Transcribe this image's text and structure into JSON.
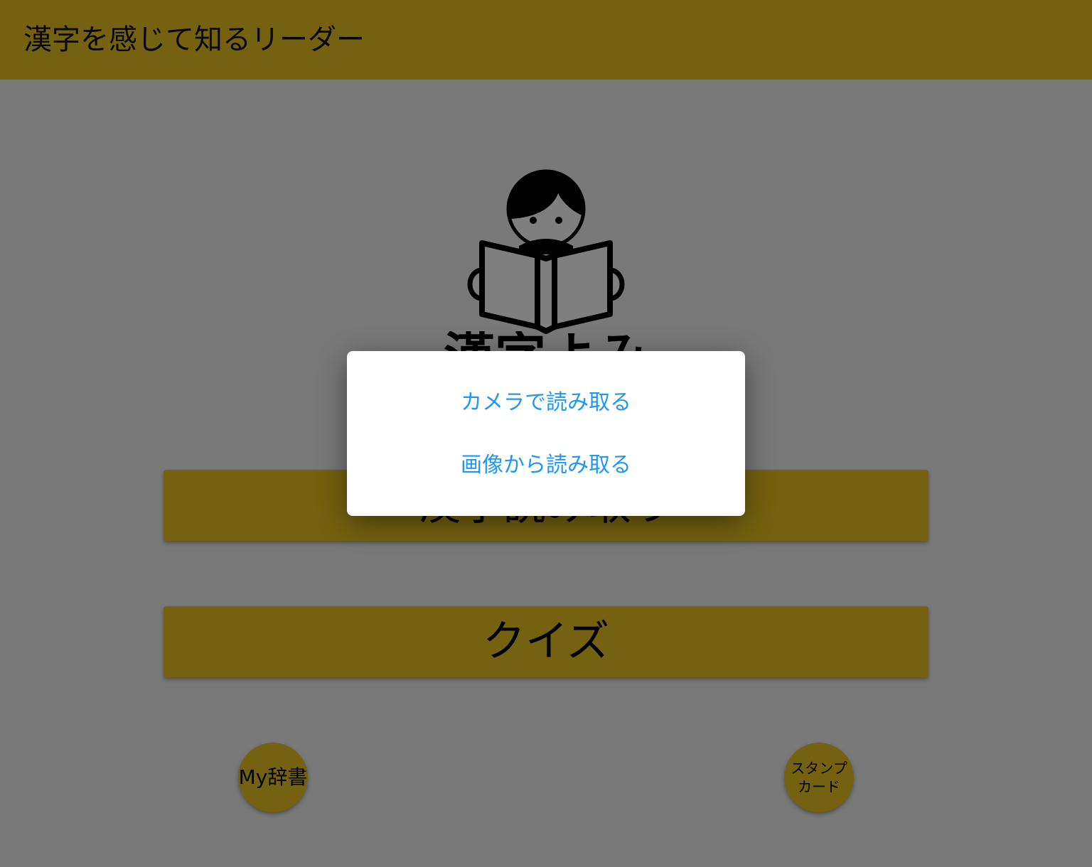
{
  "app_bar": {
    "title": "漢字を感じて知るリーダー"
  },
  "logo": {
    "icon": "person-reading-book-icon",
    "caption": "漢字よみ"
  },
  "main": {
    "read_button_label": "漢字読み取り",
    "quiz_button_label": "クイズ",
    "dictionary_button_label": "My辞書",
    "stamp_button_line1": "スタンプ",
    "stamp_button_line2": "カード"
  },
  "dialog": {
    "option_camera": "カメラで読み取る",
    "option_image": "画像から読み取る"
  },
  "colors": {
    "accent": "#e8c521",
    "dialog_text": "#2196f3",
    "background": "#f2f2f2"
  }
}
